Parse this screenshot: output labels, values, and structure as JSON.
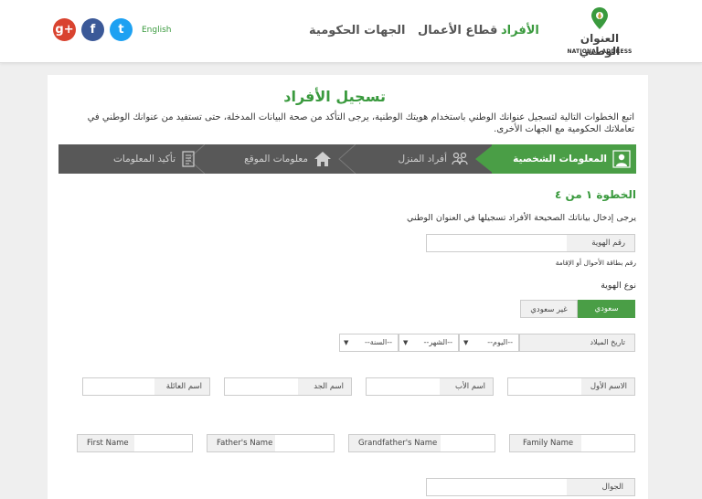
{
  "header": {
    "logo_ar": "العنوان الوطني",
    "logo_en": "NATIONAL ADDRESS",
    "nav": [
      "الأفراد",
      "قطاع الأعمال",
      "الجهات الحكومية"
    ],
    "lang": "English",
    "social": [
      "g+",
      "f",
      "t"
    ]
  },
  "page": {
    "title": "تسجيل الأفراد",
    "intro": "اتبع الخطوات التالية لتسجيل عنوانك الوطني باستخدام هويتك الوطنية، يرجى التأكد من صحة البيانات المدخلة، حتى تستفيد من عنوانك الوطني في تعاملاتك الحكومية مع الجهات الأخرى."
  },
  "steps": [
    {
      "label": "المعلومات الشخصية",
      "icon": "person-icon",
      "active": true
    },
    {
      "label": "أفراد المنزل",
      "icon": "family-icon",
      "active": false
    },
    {
      "label": "معلومات الموقع",
      "icon": "home-icon",
      "active": false
    },
    {
      "label": "تأكيد المعلومات",
      "icon": "document-icon",
      "active": false
    }
  ],
  "form": {
    "step_heading": "الخطوة ١ من ٤",
    "hint": "يرجى إدخال بياناتك الصحيحة الأفراد تسجيلها في العنوان الوطني",
    "id_label": "رقم الهوية",
    "id_value": "",
    "id_note": "رقم بطاقة الأحوال أو الإقامة",
    "id_type_label": "نوع الهوية",
    "id_type_options": [
      "سعودي",
      "غير سعودي"
    ],
    "birth_label": "تاريخ الميلاد",
    "birth_day": "--اليوم--",
    "birth_month": "--الشهر--",
    "birth_year": "--السنة--",
    "arabic_names": [
      "الاسم الأول",
      "اسم الأب",
      "اسم الجد",
      "اسم العائلة"
    ],
    "english_names": [
      "Family Name",
      "Grandfather's Name",
      "Father's Name",
      "First Name"
    ],
    "mobile_label": "الجوال"
  },
  "colors": {
    "accent": "#4a9e46",
    "step_bar": "#585858"
  }
}
